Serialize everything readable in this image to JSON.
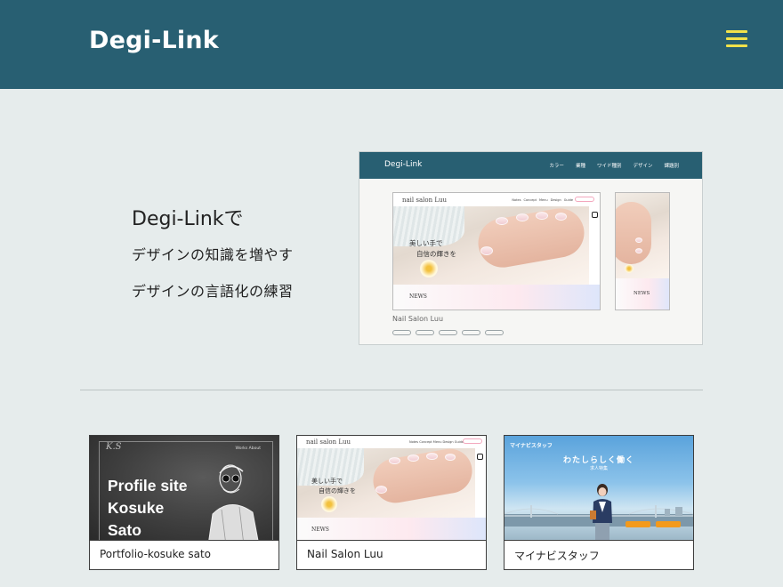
{
  "header": {
    "logo": "Degi-Link",
    "menu_icon": "hamburger-icon"
  },
  "hero": {
    "line1": "Degi-Linkで",
    "line2": "デザインの知識を増やす",
    "line3": "デザインの言語化の練習"
  },
  "mockup": {
    "logo": "Degi-Link",
    "nav": [
      "カラー",
      "業種",
      "ワイド種別",
      "デザイン",
      "課題別"
    ],
    "brand": "nail salon Luu",
    "brand_nav": [
      "Notes",
      "Concept",
      "Menu",
      "Design",
      "Guide"
    ],
    "headline_1": "美しい手で",
    "headline_2": "自信の輝きを",
    "news": "NEWS",
    "caption": "Nail Salon Luu",
    "tags_count": 5
  },
  "cards": [
    {
      "title": "Portfolio-kosuke sato",
      "image_logo": "K.S",
      "image_nav": "Works   About",
      "image_text_1": "Profile site",
      "image_text_2": "Kosuke",
      "image_text_3": "Sato"
    },
    {
      "title": "Nail Salon Luu",
      "image_brand": "nail salon Luu",
      "image_nav": "Notes  Concept  Menu  Design  Guide",
      "image_headline_1": "美しい手で",
      "image_headline_2": "自信の輝きを",
      "image_news": "NEWS"
    },
    {
      "title": "マイナビスタッフ",
      "image_logo": "マイナビスタッフ",
      "image_headline": "わたしらしく働く",
      "image_sub": "求人特集"
    }
  ],
  "colors": {
    "header_bg": "#285f72",
    "page_bg": "#e6ecec",
    "menu_accent": "#f1e24a"
  }
}
